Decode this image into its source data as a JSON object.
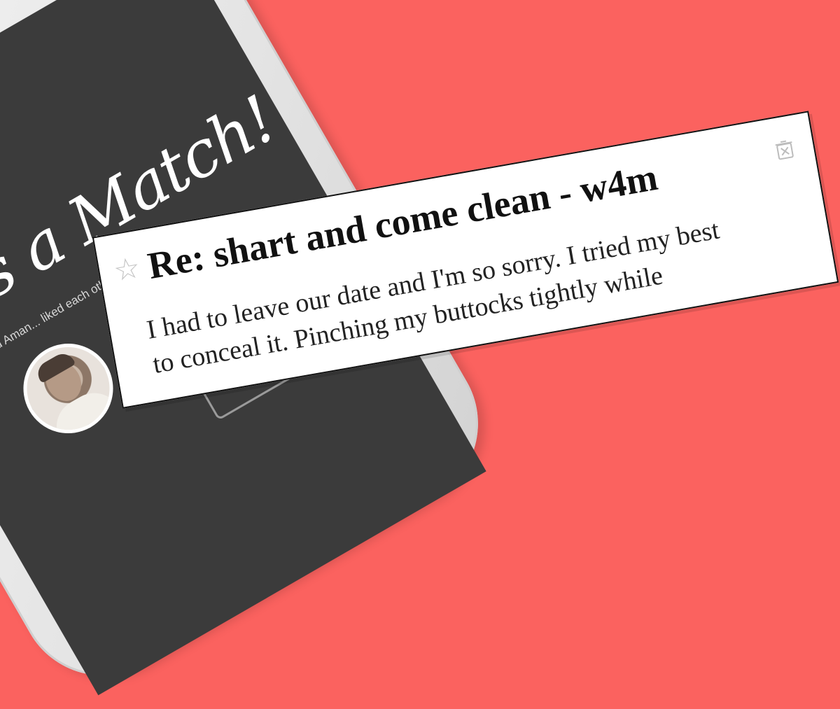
{
  "match_screen": {
    "title": "It's a Match!",
    "subtitle": "You and Aman... liked each other."
  },
  "post": {
    "title": "Re: shart and come clean - w4m",
    "body_line_1": "I had to leave our date and I'm so sorry. I tried my best",
    "body_line_2": "to conceal it. Pinching my buttocks tightly while",
    "star_icon": "star-icon",
    "delete_icon": "trash-icon"
  },
  "colors": {
    "background": "#fb625f",
    "phone_screen": "#3b3b3b",
    "card": "#ffffff"
  }
}
